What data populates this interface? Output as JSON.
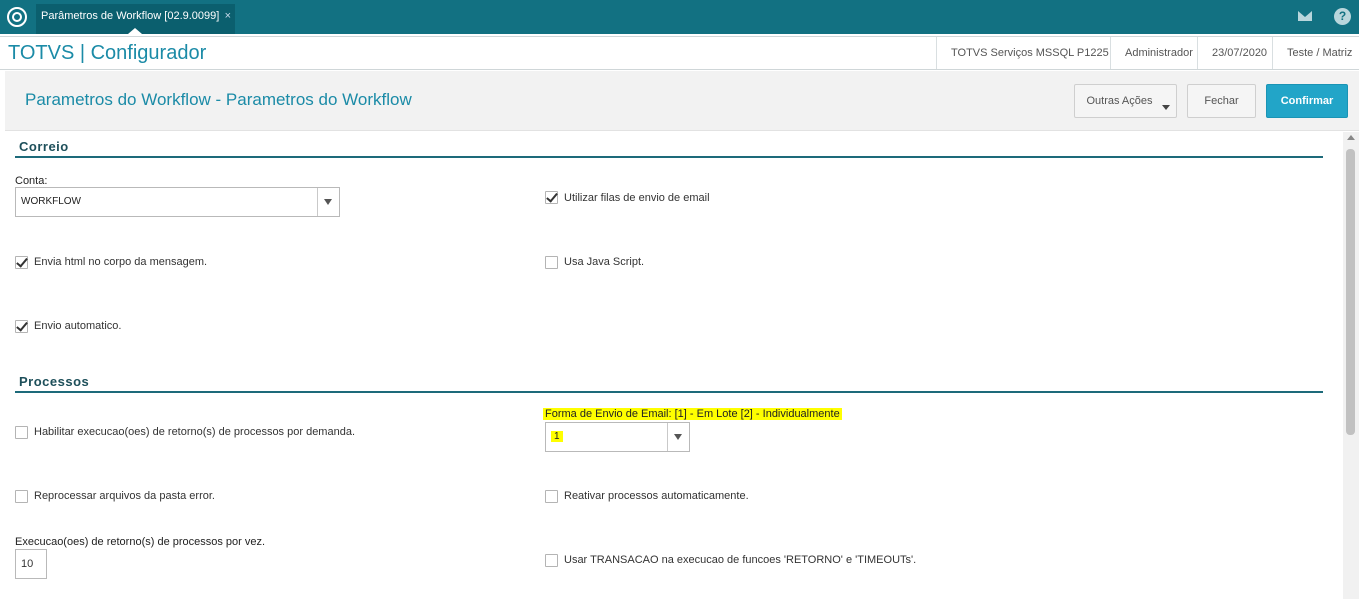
{
  "window": {
    "tab_label": "Parâmetros de Workflow [02.9.0099]",
    "tab_close": "×",
    "help_label": "?"
  },
  "app": {
    "title": "TOTVS | Configurador",
    "environment": "TOTVS Serviços MSSQL P1225",
    "user": "Administrador",
    "date": "23/07/2020",
    "company": "Teste / Matriz"
  },
  "page": {
    "title": "Parametros do Workflow - Parametros do Workflow",
    "actions": {
      "more": "Outras Ações",
      "close": "Fechar",
      "confirm": "Confirmar"
    }
  },
  "correio": {
    "section_title": "Correio",
    "conta_label": "Conta:",
    "conta_value": "WORKFLOW",
    "filas_envio": {
      "label": "Utilizar filas de envio de email",
      "checked": true
    },
    "envia_html": {
      "label": "Envia html no corpo da mensagem.",
      "checked": true
    },
    "java_script": {
      "label": "Usa Java Script.",
      "checked": false
    },
    "envio_automatico": {
      "label": "Envio automatico.",
      "checked": true
    }
  },
  "processos": {
    "section_title": "Processos",
    "habilitar_execucao": {
      "label": "Habilitar execucao(oes) de retorno(s) de processos por demanda.",
      "checked": false
    },
    "forma_envio_label": "Forma de Envio de Email:  [1] - Em Lote [2] - Individualmente",
    "forma_envio_value": "1",
    "reprocessar": {
      "label": "Reprocessar arquivos da pasta error.",
      "checked": false
    },
    "reativar": {
      "label": "Reativar processos automaticamente.",
      "checked": false
    },
    "execucoes_label": "Execucao(oes) de retorno(s) de processos por vez.",
    "execucoes_value": "10",
    "usar_transacao": {
      "label": "Usar TRANSACAO na execucao de funcoes 'RETORNO' e 'TIMEOUTs'.",
      "checked": false
    }
  },
  "icons": {
    "logo": "totvs-logo-icon",
    "mail": "mail-icon",
    "help": "help-icon"
  },
  "colors": {
    "topbar": "#127182",
    "accent": "#1b8ba7",
    "confirm_button": "#22a5c8",
    "highlight": "#ffff00"
  }
}
